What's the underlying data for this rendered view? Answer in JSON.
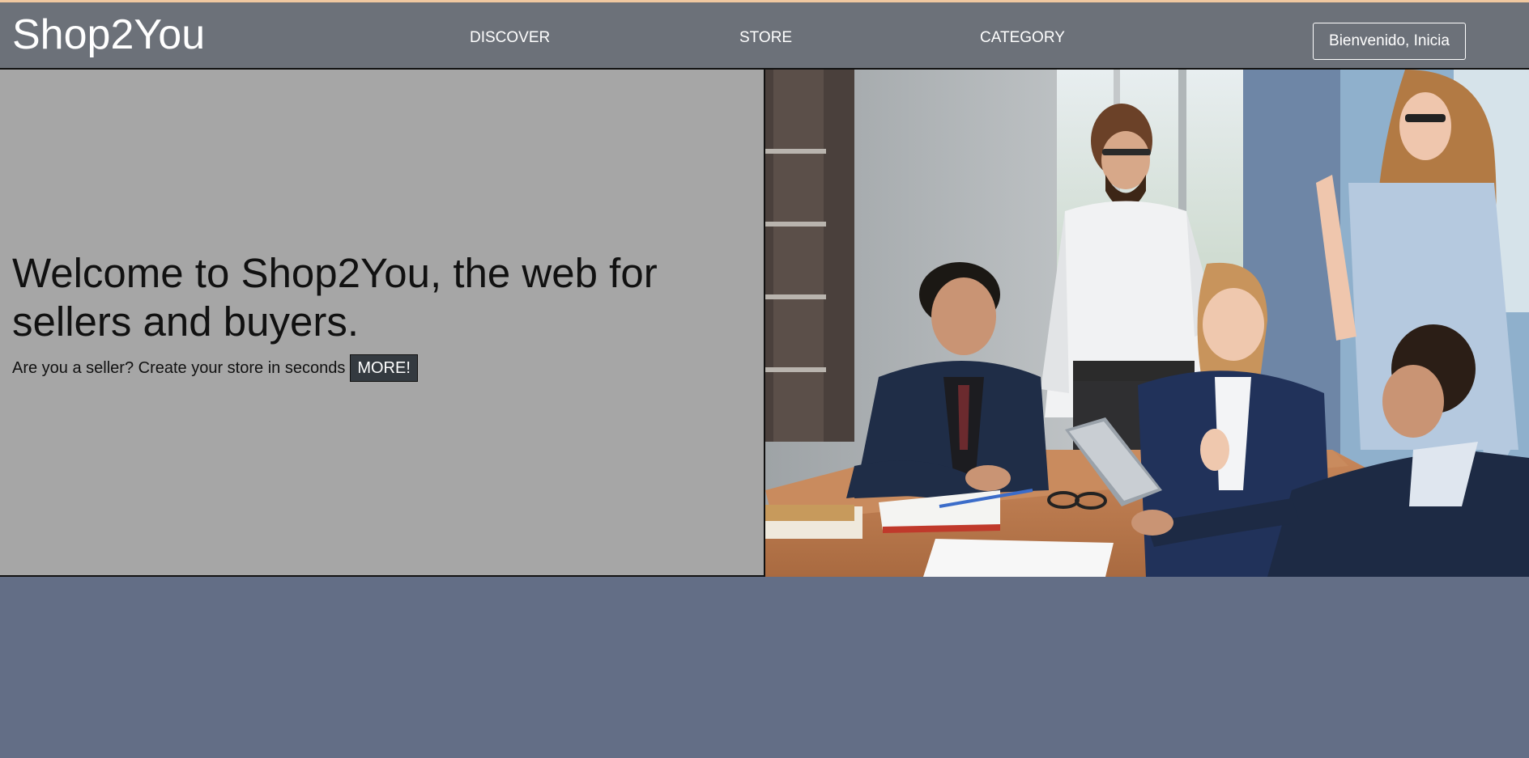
{
  "navbar": {
    "brand": "Shop2You",
    "links": [
      {
        "label": "DISCOVER"
      },
      {
        "label": "STORE"
      },
      {
        "label": "CATEGORY"
      }
    ],
    "login_label": "Bienvenido, Inicia Sesion"
  },
  "hero": {
    "title": "Welcome to Shop2You, the web for sellers and buyers.",
    "subtitle": "Are you a seller? Create your store in seconds",
    "more_label": "MORE!",
    "image_icon": "business-team-meeting-photo"
  },
  "colors": {
    "navbar_bg": "#6c7179",
    "hero_left_bg": "#a6a6a6",
    "page_bg": "#636e86",
    "button_dark": "#343a40",
    "top_accent": "#f0c8a0"
  }
}
